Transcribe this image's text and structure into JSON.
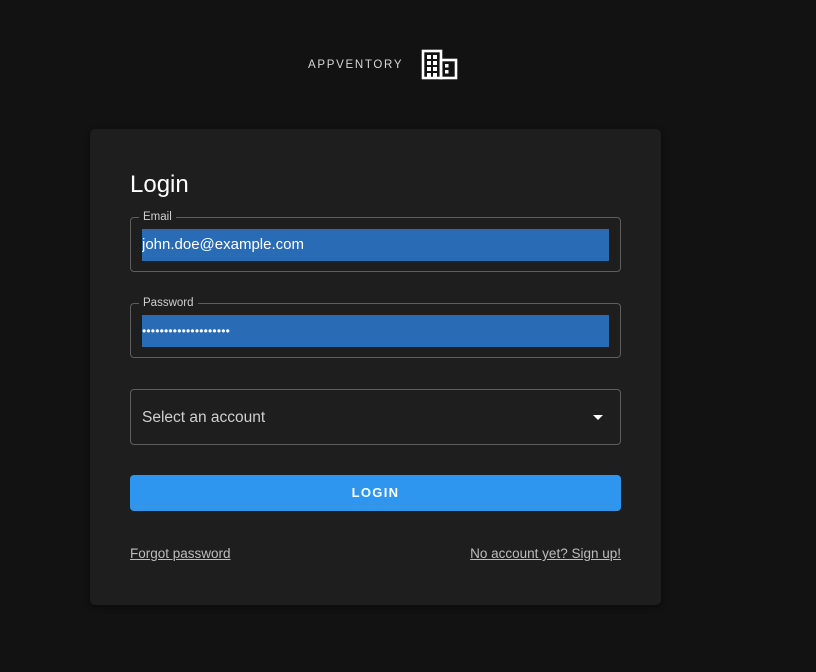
{
  "header": {
    "brand_name": "APPVENTORY",
    "brand_icon": "building-icon"
  },
  "login_card": {
    "title": "Login",
    "email": {
      "label": "Email",
      "value": "john.doe@example.com"
    },
    "password": {
      "label": "Password",
      "masked_value": "••••••••••••••••••••"
    },
    "account_select": {
      "placeholder": "Select an account",
      "icon": "dropdown-arrow-icon"
    },
    "login_button_label": "LOGIN",
    "forgot_password_link": "Forgot password",
    "signup_link": "No account yet? Sign up!"
  },
  "colors": {
    "background": "#121212",
    "card": "#1e1e1e",
    "primary": "#2f96f0",
    "selection": "#2a6bb5"
  }
}
